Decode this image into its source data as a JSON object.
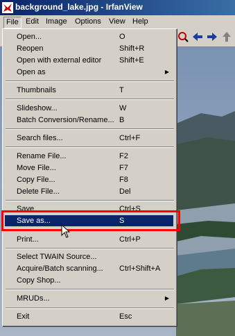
{
  "window": {
    "title": "background_lake.jpg - IrfanView",
    "icon": "irfanview-app-icon"
  },
  "menubar": {
    "items": [
      {
        "label": "File"
      },
      {
        "label": "Edit"
      },
      {
        "label": "Image"
      },
      {
        "label": "Options"
      },
      {
        "label": "View"
      },
      {
        "label": "Help"
      }
    ]
  },
  "toolbar": {
    "icons": [
      "zoom-icon",
      "previous-arrow-icon",
      "next-arrow-icon",
      "upload-icon"
    ]
  },
  "file_menu": {
    "items": [
      {
        "label": "Open...",
        "shortcut": "O"
      },
      {
        "label": "Reopen",
        "shortcut": "Shift+R"
      },
      {
        "label": "Open with external editor",
        "shortcut": "Shift+E"
      },
      {
        "label": "Open as",
        "shortcut": "",
        "submenu": true
      },
      {
        "label": "Thumbnails",
        "shortcut": "T"
      },
      {
        "label": "Slideshow...",
        "shortcut": "W"
      },
      {
        "label": "Batch Conversion/Rename...",
        "shortcut": "B"
      },
      {
        "label": "Search files...",
        "shortcut": "Ctrl+F"
      },
      {
        "label": "Rename File...",
        "shortcut": "F2"
      },
      {
        "label": "Move File...",
        "shortcut": "F7"
      },
      {
        "label": "Copy File...",
        "shortcut": "F8"
      },
      {
        "label": "Delete File...",
        "shortcut": "Del"
      },
      {
        "label": "Save",
        "shortcut": "Ctrl+S"
      },
      {
        "label": "Save as...",
        "shortcut": "S",
        "selected": true
      },
      {
        "label": "Print...",
        "shortcut": "Ctrl+P"
      },
      {
        "label": "Select TWAIN Source...",
        "shortcut": ""
      },
      {
        "label": "Acquire/Batch scanning...",
        "shortcut": "Ctrl+Shift+A"
      },
      {
        "label": "Copy Shop...",
        "shortcut": ""
      },
      {
        "label": "MRUDs...",
        "shortcut": "",
        "submenu": true
      },
      {
        "label": "Exit",
        "shortcut": "Esc"
      }
    ]
  },
  "colors": {
    "selection": "#0a246a",
    "highlight_box": "#ff0000",
    "titlebar": "#0a246a"
  }
}
